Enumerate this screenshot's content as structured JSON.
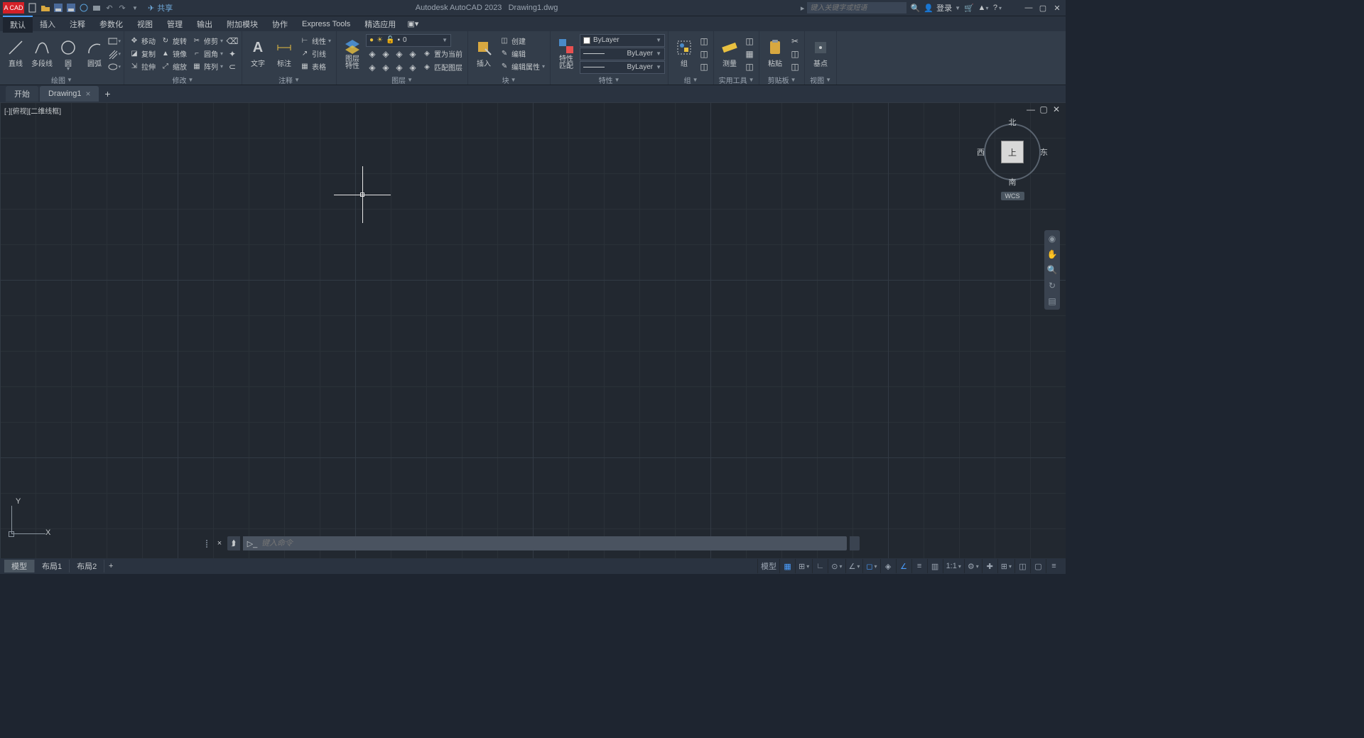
{
  "app": {
    "name": "Autodesk AutoCAD 2023",
    "document": "Drawing1.dwg",
    "logo": "A CAD"
  },
  "titlebar": {
    "share": "共享",
    "search_placeholder": "键入关键字或短语",
    "login": "登录"
  },
  "menus": [
    "默认",
    "插入",
    "注释",
    "参数化",
    "视图",
    "管理",
    "输出",
    "附加模块",
    "协作",
    "Express Tools",
    "精选应用"
  ],
  "ribbon": {
    "draw": {
      "title": "绘图",
      "line": "直线",
      "polyline": "多段线",
      "circle": "圆",
      "arc": "圆弧"
    },
    "modify": {
      "title": "修改",
      "move": "移动",
      "rotate": "旋转",
      "trim": "修剪",
      "copy": "复制",
      "mirror": "镜像",
      "fillet": "圆角",
      "stretch": "拉伸",
      "scale": "缩放",
      "array": "阵列"
    },
    "annotation": {
      "title": "注释",
      "text": "文字",
      "dim": "标注",
      "leader": "引线",
      "table": "表格"
    },
    "annot_ext": {
      "linear": "线性"
    },
    "layers": {
      "title": "图层",
      "props": "图层\n特性",
      "current": "0",
      "set_current": "置为当前",
      "match": "匹配图层"
    },
    "block": {
      "title": "块",
      "insert": "插入",
      "create": "创建",
      "edit": "编辑",
      "edit_attr": "编辑属性"
    },
    "properties": {
      "title": "特性",
      "match": "特性\n匹配",
      "bylayer": "ByLayer"
    },
    "group": {
      "title": "组",
      "group": "组"
    },
    "utilities": {
      "title": "实用工具",
      "measure": "测量"
    },
    "clipboard": {
      "title": "剪贴板",
      "paste": "粘贴"
    },
    "view": {
      "title": "视图",
      "basepoint": "基点"
    }
  },
  "doc_tabs": {
    "start": "开始",
    "drawing": "Drawing1"
  },
  "viewport": {
    "label": "[-][俯视][二维线框]"
  },
  "viewcube": {
    "top": "上",
    "n": "北",
    "s": "南",
    "e": "东",
    "w": "西",
    "wcs": "WCS"
  },
  "ucs": {
    "x": "X",
    "y": "Y"
  },
  "command": {
    "placeholder": "键入命令"
  },
  "layout_tabs": {
    "model": "模型",
    "layout1": "布局1",
    "layout2": "布局2"
  },
  "status": {
    "model": "模型",
    "scale": "1:1"
  }
}
